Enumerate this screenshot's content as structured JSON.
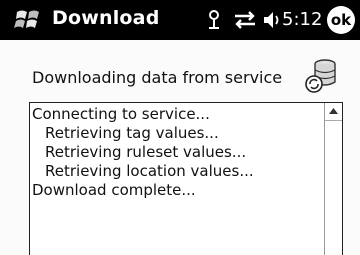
{
  "title_bar": {
    "title": "Download",
    "clock": "5:12",
    "ok_label": "ok"
  },
  "main": {
    "heading": "Downloading data from service",
    "log_lines": [
      {
        "text": "Connecting to service...",
        "indent": false
      },
      {
        "text": "Retrieving tag values...",
        "indent": true
      },
      {
        "text": "Retrieving ruleset values...",
        "indent": true
      },
      {
        "text": "Retrieving location values...",
        "indent": true
      },
      {
        "text": "Download complete...",
        "indent": false
      }
    ]
  },
  "icons": [
    "windows-start-icon",
    "antenna-icon",
    "sync-icon",
    "speaker-icon",
    "database-sync-icon",
    "scroll-up-icon"
  ],
  "colors": {
    "title_bar_bg": "#000000",
    "title_text": "#ffffff",
    "background": "#fbfbfb"
  }
}
